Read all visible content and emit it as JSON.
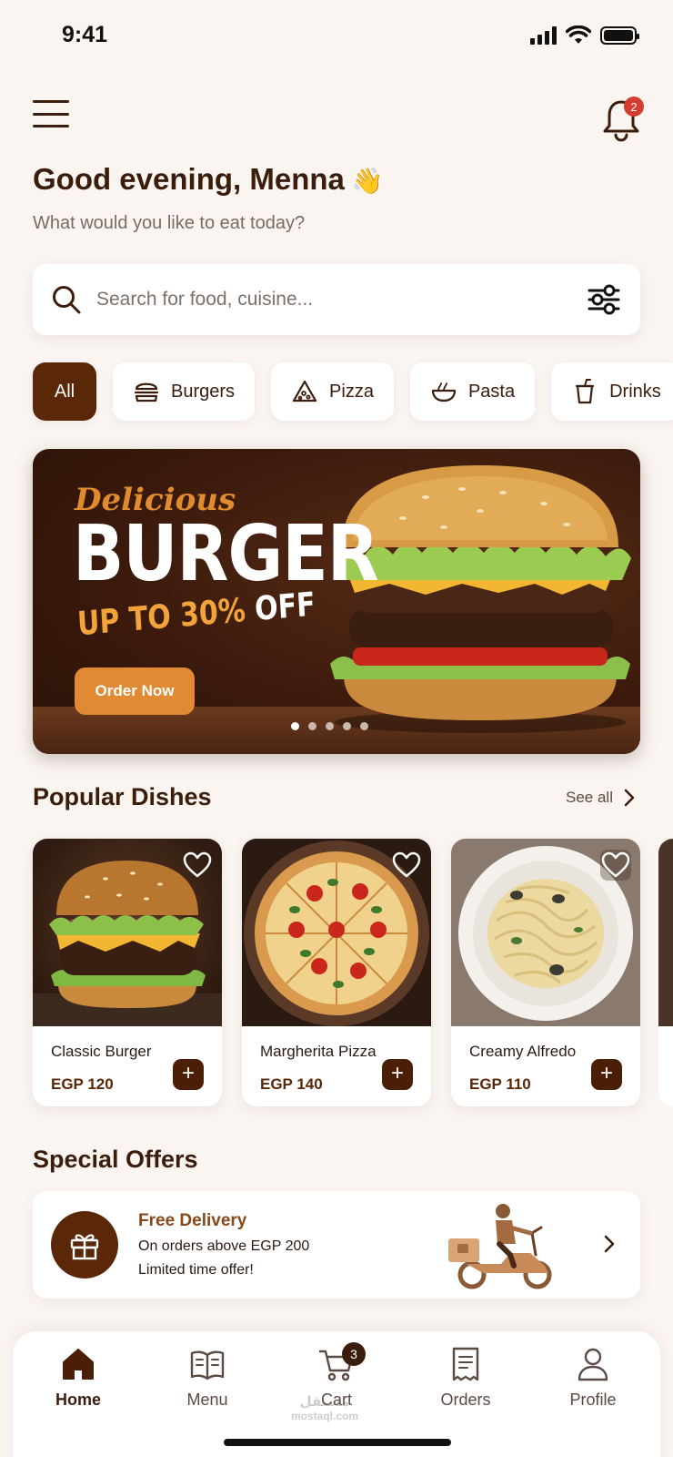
{
  "status_bar": {
    "time": "9:41"
  },
  "header": {
    "menu_icon": "hamburger-menu-icon",
    "notification_icon": "bell-icon",
    "notification_count": "2",
    "greeting": "Good evening, Menna",
    "greeting_emoji": "👋",
    "subtitle": "What would you like to eat today?"
  },
  "search": {
    "placeholder": "Search for food, cuisine...",
    "value": "",
    "icon": "search-icon",
    "filter_icon": "filter-sliders-icon"
  },
  "categories": [
    {
      "label": "All",
      "active": true
    },
    {
      "label": "Burgers",
      "icon": "burger-icon"
    },
    {
      "label": "Pizza",
      "icon": "pizza-icon"
    },
    {
      "label": "Pasta",
      "icon": "pasta-bowl-icon"
    },
    {
      "label": "Drinks",
      "icon": "drink-cup-icon"
    }
  ],
  "banner": {
    "script_text": "Delicious",
    "headline": "BURGER",
    "discount_prefix": "UP TO 30%",
    "discount_suffix": "OFF",
    "button_label": "Order Now",
    "slide_count": 5,
    "active_slide": 1
  },
  "popular": {
    "title": "Popular Dishes",
    "see_all": "See all",
    "dishes": [
      {
        "name": "Classic Burger",
        "price": "EGP 120"
      },
      {
        "name": "Margherita Pizza",
        "price": "EGP 140"
      },
      {
        "name": "Creamy Alfredo",
        "price": "EGP 110"
      }
    ]
  },
  "offers": {
    "title": "Special Offers",
    "card": {
      "title": "Free Delivery",
      "line1": "On orders above EGP 200",
      "line2": "Limited time offer!",
      "icon": "gift-icon"
    }
  },
  "bottom_nav": {
    "items": [
      {
        "label": "Home",
        "icon": "home-icon",
        "active": true
      },
      {
        "label": "Menu",
        "icon": "menu-book-icon"
      },
      {
        "label": "Cart",
        "icon": "cart-icon",
        "badge": "3"
      },
      {
        "label": "Orders",
        "icon": "receipt-icon"
      },
      {
        "label": "Profile",
        "icon": "profile-icon"
      }
    ]
  },
  "watermark": {
    "arabic": "مستقل",
    "latin": "mostaql.com"
  },
  "colors": {
    "primary": "#5b2709",
    "accent": "#e08a34",
    "background": "#faf5f1",
    "badge_red": "#d63b2f"
  }
}
